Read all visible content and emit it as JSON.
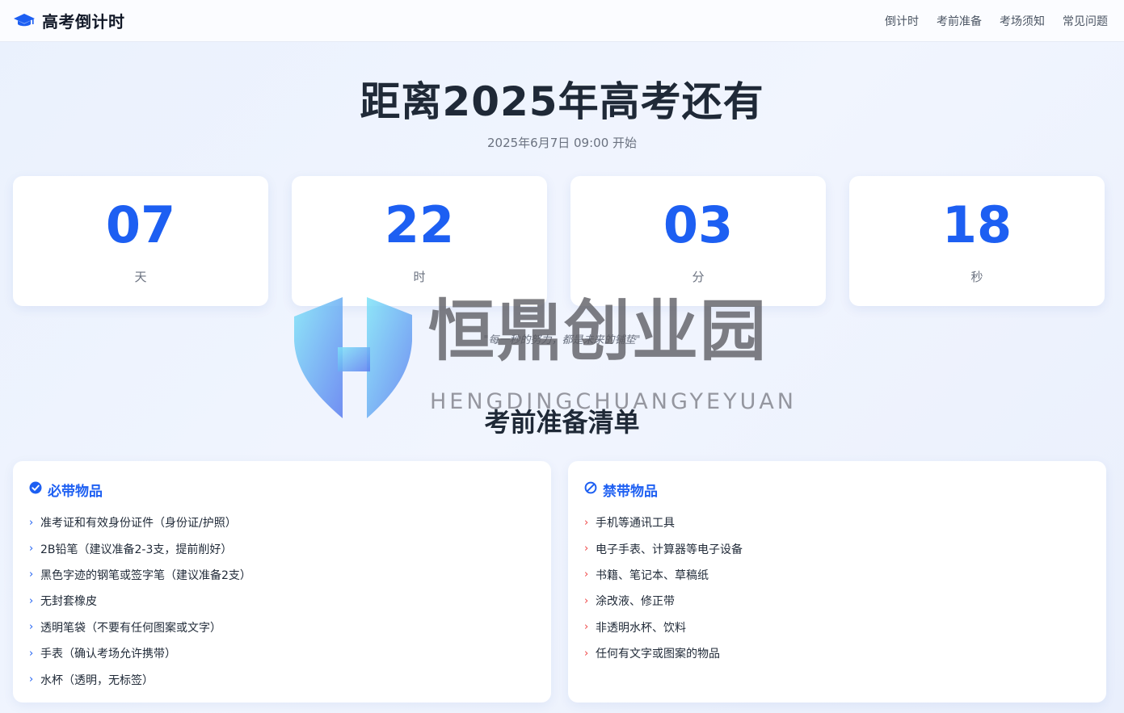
{
  "brand": {
    "title": "高考倒计时",
    "icon": "graduation-cap-icon"
  },
  "nav": {
    "links": [
      "倒计时",
      "考前准备",
      "考场须知",
      "常见问题"
    ]
  },
  "hero": {
    "title": "距离2025年高考还有",
    "subtitle": "2025年6月7日 09:00 开始"
  },
  "countdown": [
    {
      "value": "07",
      "unit": "天"
    },
    {
      "value": "22",
      "unit": "时"
    },
    {
      "value": "03",
      "unit": "分"
    },
    {
      "value": "18",
      "unit": "秒"
    }
  ],
  "quote": "\"每一秒的努力，都是未来的铺垫\"",
  "section": {
    "title": "考前准备清单"
  },
  "must_bring": {
    "title": "必带物品",
    "icon": "check-circle-icon",
    "items": [
      "准考证和有效身份证件（身份证/护照）",
      "2B铅笔（建议准备2-3支，提前削好）",
      "黑色字迹的钢笔或签字笔（建议准备2支）",
      "无封套橡皮",
      "透明笔袋（不要有任何图案或文字）",
      "手表（确认考场允许携带）",
      "水杯（透明，无标签）"
    ]
  },
  "prohibited": {
    "title": "禁带物品",
    "icon": "ban-icon",
    "items": [
      "手机等通讯工具",
      "电子手表、计算器等电子设备",
      "书籍、笔记本、草稿纸",
      "涂改液、修正带",
      "非透明水杯、饮料",
      "任何有文字或图案的物品"
    ]
  },
  "watermark": {
    "cn": "恒鼎创业园",
    "en": "HENGDINGCHUANGYEYUAN"
  },
  "colors": {
    "accent": "#1d5ff2",
    "danger": "#ef4444",
    "text": "#1f2937",
    "muted": "#6b7280"
  }
}
